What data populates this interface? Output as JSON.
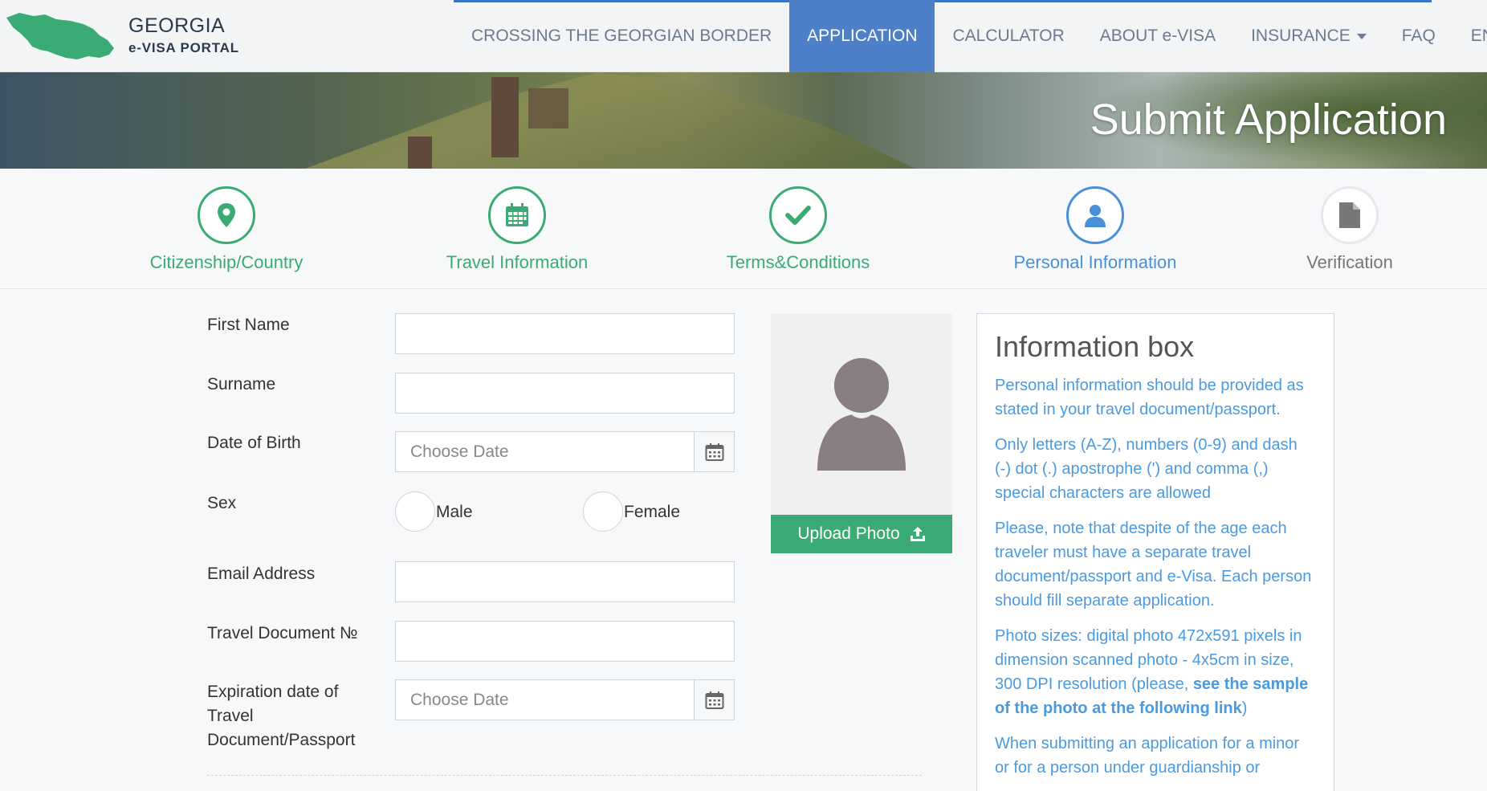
{
  "header": {
    "logo_title": "GEORGIA",
    "logo_subtitle": "e-VISA PORTAL",
    "nav": [
      {
        "label": "CROSSING THE GEORGIAN BORDER"
      },
      {
        "label": "APPLICATION"
      },
      {
        "label": "CALCULATOR"
      },
      {
        "label": "ABOUT e-VISA"
      },
      {
        "label": "INSURANCE"
      },
      {
        "label": "FAQ"
      },
      {
        "label": "EN"
      }
    ],
    "active_nav": "APPLICATION"
  },
  "banner": {
    "title": "Submit Application"
  },
  "steps": [
    {
      "label": "Citizenship/Country",
      "status": "done",
      "icon": "map-pin-icon"
    },
    {
      "label": "Travel Information",
      "status": "done",
      "icon": "calendar-icon"
    },
    {
      "label": "Terms&Conditions",
      "status": "done",
      "icon": "check-icon"
    },
    {
      "label": "Personal Information",
      "status": "current",
      "icon": "user-icon"
    },
    {
      "label": "Verification",
      "status": "pending",
      "icon": "document-icon"
    }
  ],
  "form": {
    "first_name_label": "First Name",
    "first_name_value": "",
    "surname_label": "Surname",
    "surname_value": "",
    "dob_label": "Date of Birth",
    "dob_placeholder": "Choose Date",
    "sex_label": "Sex",
    "sex_male": "Male",
    "sex_female": "Female",
    "email_label": "Email Address",
    "email_value": "",
    "travel_doc_label": "Travel Document №",
    "travel_doc_value": "",
    "expiration_label": "Expiration date of Travel Document/Passport",
    "expiration_placeholder": "Choose Date"
  },
  "photo": {
    "upload_label": "Upload Photo"
  },
  "info_box": {
    "title": "Information box",
    "p1": "Personal information should be provided as stated in your travel document/passport.",
    "p2": "Only letters (A-Z), numbers (0-9) and dash (-) dot (.) apostrophe (') and comma (,) special characters are allowed",
    "p3": "Please, note that despite of the age each traveler must have a separate travel document/passport and e-Visa. Each person should fill separate application.",
    "p4_prefix": "Photo sizes: digital photo 472x591 pixels in dimension scanned photo - 4x5cm in size, 300 DPI resolution (please, ",
    "p4_link": "see the sample of the photo at the following link",
    "p4_suffix": ")",
    "p5": "When submitting an application for a minor or for a person under guardianship or"
  },
  "colors": {
    "accent_blue": "#4e7fc9",
    "step_done_green": "#3aab74",
    "step_current_blue": "#4a90d9",
    "info_text_blue": "#4a9ae0"
  }
}
